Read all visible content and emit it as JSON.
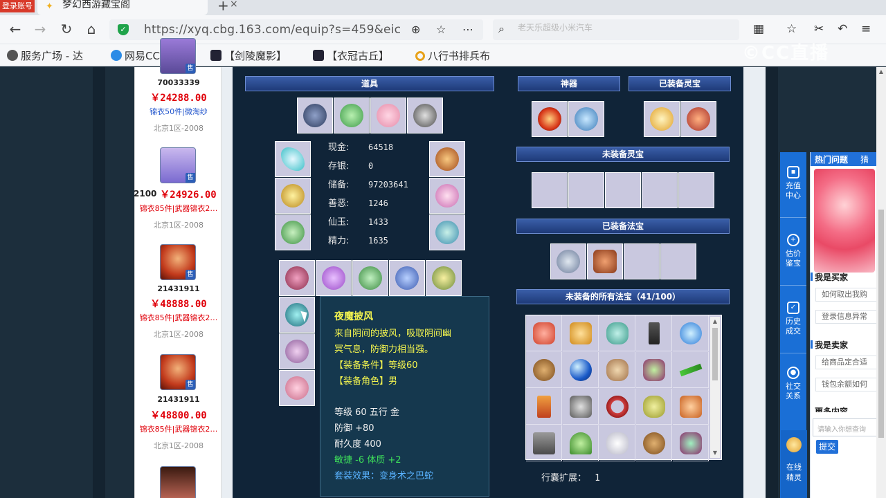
{
  "browser": {
    "login_badge": "登录账号",
    "tab_title": "梦幻西游藏宝阁",
    "tab_close": "×",
    "new_tab": "+",
    "url": "https://xyq.cbg.163.com/equip?s=459&eic",
    "search_placeholder": "老天乐超级小米汽车",
    "bookmarks": [
      "服务广场 - 达",
      "网易CC视频",
      "【剑陵魔影】",
      "【衣冠古丘】",
      "八行书排兵布"
    ],
    "watermark": "©CC直播"
  },
  "listing": {
    "items": [
      {
        "id": "70033339",
        "price": "￥24288.00",
        "tags": "锦衣50件|微淘纱",
        "tags_color": "#2255cc",
        "server": "北京1区-2008",
        "prefix": ""
      },
      {
        "id": "",
        "price": "￥24926.00",
        "tags": "锦衣85件|武器锦衣2…",
        "tags_color": "#e0000a",
        "server": "北京1区-2008",
        "prefix": "2100"
      },
      {
        "id": "21431911",
        "price": "￥48888.00",
        "tags": "锦衣85件|武器锦衣2…",
        "tags_color": "#e0000a",
        "server": "北京1区-2008",
        "prefix": ""
      },
      {
        "id": "21431911",
        "price": "￥48800.00",
        "tags": "锦衣85件|武器锦衣2…",
        "tags_color": "#e0000a",
        "server": "北京1区-2008",
        "prefix": ""
      }
    ],
    "sell_badge": "售"
  },
  "sections": {
    "props": "道具",
    "shenqi": "神器",
    "equipped_lingbao": "已装备灵宝",
    "unequipped_lingbao": "未装备灵宝",
    "equipped_fabao": "已装备法宝",
    "all_fabao": "未装备的所有法宝（41/100）"
  },
  "stats": [
    {
      "k": "现金:",
      "v": "64518"
    },
    {
      "k": "存银:",
      "v": "0"
    },
    {
      "k": "储备:",
      "v": "97203641"
    },
    {
      "k": "善恶:",
      "v": "1246"
    },
    {
      "k": "仙玉:",
      "v": "1433"
    },
    {
      "k": "精力:",
      "v": "1635"
    }
  ],
  "tooltip": {
    "name": "夜魔披风",
    "desc1": "来自阴间的披风，吸取阴间幽",
    "desc2": "冥气息，防御力相当强。",
    "req1": "【装备条件】等级60",
    "req2": "【装备角色】男",
    "level": "等级 60 五行 金",
    "defense": "防御 +80",
    "durability": "耐久度 400",
    "bonus": "敏捷 -6 体质 +2",
    "set": "套装效果：变身术之巴蛇"
  },
  "bag": {
    "label": "行囊扩展：",
    "value": "1"
  },
  "service": {
    "items": [
      "充值中心",
      "估价鉴宝",
      "历史成交",
      "社交关系"
    ],
    "bottom": "在线精灵"
  },
  "help": {
    "tab1": "热门问题",
    "tab2": "猜",
    "buyer": "我是买家",
    "buyer_q": [
      "如何取出我购",
      "登录信息异常"
    ],
    "seller": "我是卖家",
    "seller_q": [
      "给商品定合适",
      "钱包余额如何"
    ],
    "more": "更多内容",
    "input_placeholder": "请输入你想查询",
    "submit": "提交"
  },
  "colors": {
    "page_bg": "#1c2e3c",
    "section_header": "#2a4c96",
    "slot": "#c9c8df",
    "tooltip_yellow": "#f3f44f",
    "tooltip_green": "#3ee05a",
    "tooltip_blue": "#59b2ff",
    "price_red": "#e0000a",
    "service_blue": "#1a6fd6"
  }
}
